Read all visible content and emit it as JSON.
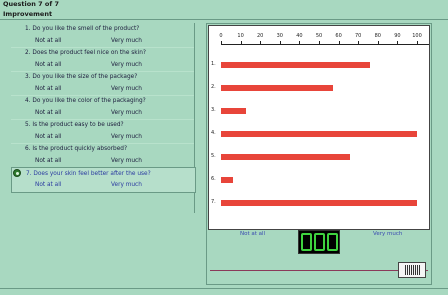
{
  "header": {
    "title": "Question 7 of 7",
    "subtitle": "Improvement"
  },
  "questions": [
    {
      "text": "1.  Do you like the smell of the product?",
      "low": "Not at all",
      "high": "Very much"
    },
    {
      "text": "2.  Does the product feel nice on the skin?",
      "low": "Not at all",
      "high": "Very much"
    },
    {
      "text": "3.  Do you like the size of the package?",
      "low": "Not at all",
      "high": "Very much"
    },
    {
      "text": "4.  Do you like the color of the packaging?",
      "low": "Not at all",
      "high": "Very much"
    },
    {
      "text": "5.  Is the product easy to be used?",
      "low": "Not at all",
      "high": "Very much"
    },
    {
      "text": "6.  Is the product quickly absorbed?",
      "low": "Not at all",
      "high": "Very much"
    },
    {
      "text": "7.  Does your skin feel better after the use?",
      "low": "Not at all",
      "high": "Very much"
    }
  ],
  "selected_question": 7,
  "chart_data": {
    "type": "bar",
    "orientation": "horizontal",
    "categories": [
      "1.",
      "2.",
      "3.",
      "4.",
      "5.",
      "6.",
      "7."
    ],
    "values": [
      76,
      57,
      13,
      100,
      66,
      6,
      100
    ],
    "xlim": [
      0,
      100
    ],
    "xticks": [
      "0",
      "10",
      "20",
      "30",
      "40",
      "50",
      "60",
      "70",
      "80",
      "90",
      "100"
    ],
    "bar_color": "#e8453a"
  },
  "scale": {
    "low_label": "Not at all",
    "high_label": "Very much"
  },
  "display": {
    "value_shown": "100"
  },
  "slider": {
    "value": 100
  },
  "colors": {
    "background": "#a8d8c0",
    "bar": "#e8453a",
    "lcd": "#3fd23f",
    "link": "#3a4ab0"
  }
}
